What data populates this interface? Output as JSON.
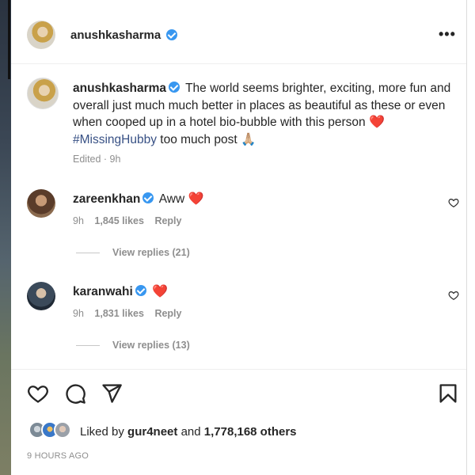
{
  "post": {
    "author": "anushkasharma",
    "more_label": "•••",
    "caption": {
      "username": "anushkasharma",
      "text_1": "The world seems brighter, exciting, more fun and overall just much much better in places as beautiful as these or even when cooped up in a hotel bio-bubble with this person",
      "heart": "❤️",
      "hashtag": "#MissingHubby",
      "text_2": "too much post 🙏🏼",
      "meta": "Edited · 9h"
    },
    "comments": [
      {
        "username": "zareenkhan",
        "text": "Aww",
        "emoji": "❤️",
        "time": "9h",
        "likes": "1,845 likes",
        "reply_label": "Reply",
        "view_replies": "View replies (21)"
      },
      {
        "username": "karanwahi",
        "text": "",
        "emoji": "❤️",
        "time": "9h",
        "likes": "1,831 likes",
        "reply_label": "Reply",
        "view_replies": "View replies (13)"
      }
    ],
    "liked_by": {
      "prefix": "Liked by",
      "user": "gur4neet",
      "middle": "and",
      "others": "1,778,168 others"
    },
    "timestamp": "9 HOURS AGO"
  },
  "icons": [
    "heart-icon",
    "comment-icon",
    "share-icon",
    "save-icon",
    "more-icon",
    "verified-icon"
  ],
  "colors": {
    "verified": "#3897f0",
    "hashtag": "#385185",
    "meta": "#8e8e8e",
    "heart": "#e0245e"
  }
}
